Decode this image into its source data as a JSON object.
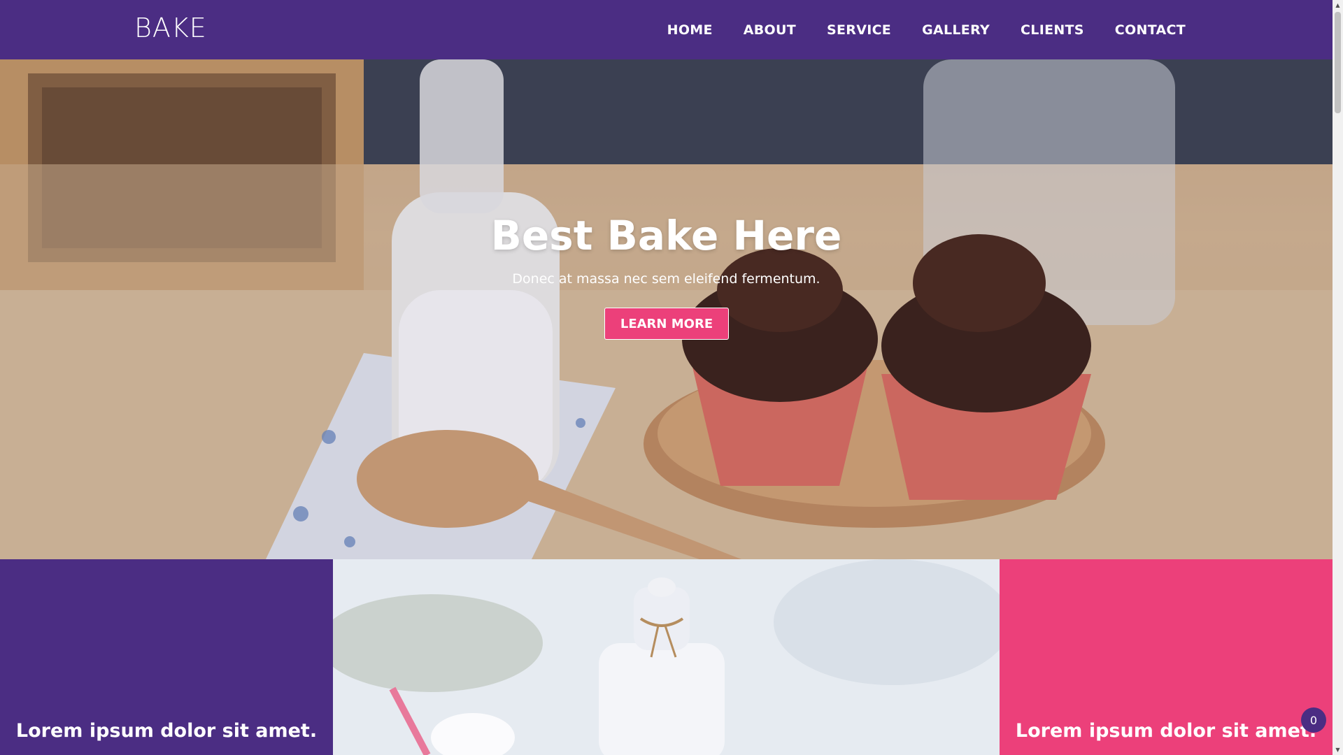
{
  "header": {
    "logo": "BAKE",
    "nav": [
      "HOME",
      "ABOUT",
      "SERVICE",
      "GALLERY",
      "CLIENTS",
      "CONTACT"
    ]
  },
  "hero": {
    "title": "Best Bake Here",
    "subtitle": "Donec at massa nec sem eleifend fermentum.",
    "button_label": "LEARN MORE"
  },
  "features": {
    "left_text": "Lorem ipsum dolor sit amet.",
    "right_text": "Lorem ipsum dolor sit amet."
  },
  "badge": {
    "count": "0"
  },
  "scrollbar": {
    "up_arrow": "▲",
    "down_arrow": "▼"
  },
  "colors": {
    "brand_purple": "#4b2d83",
    "accent_pink": "#ec407a",
    "text_light": "#ffffff"
  },
  "icons": {
    "scroll_up": "triangle-up-icon",
    "scroll_down": "triangle-down-icon"
  }
}
